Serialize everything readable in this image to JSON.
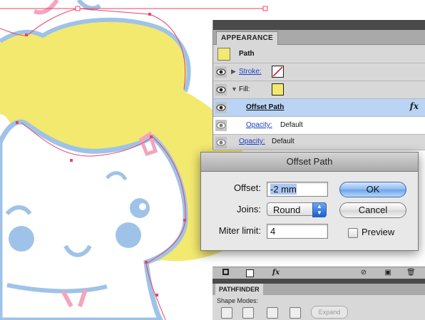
{
  "colors": {
    "artwork_yellow": "#f3e96f",
    "artwork_blue": "#9fc3e8",
    "artwork_pink": "#f2a5bd",
    "selection_red": "#e8446a",
    "dialog_accent_blue": "#6aa3ea",
    "panel_highlight": "#b9d4f5"
  },
  "appearance": {
    "tab_label": "APPEARANCE",
    "path_label": "Path",
    "stroke_label": "Stroke:",
    "fill_label": "Fill:",
    "offset_path_label": "Offset Path",
    "fx_symbol": "fx",
    "opacity_label": "Opacity:",
    "opacity_value": "Default",
    "opacity2_label": "Opacity:",
    "opacity2_value": "Default",
    "icons": [
      "eye-icon",
      "disclosure-triangle-icon",
      "none-swatch-icon",
      "yellow-swatch-icon"
    ]
  },
  "toolbar": {
    "icons": [
      "new-stroke-icon",
      "new-fill-icon",
      "fx-menu-icon",
      "clear-appearance-icon",
      "duplicate-item-icon",
      "trash-icon"
    ],
    "fx_label": "fx"
  },
  "pathfinder": {
    "tab_label": "PATHFINDER",
    "shape_modes_label": "Shape Modes:",
    "expand_label": "Expand"
  },
  "dialog": {
    "title": "Offset Path",
    "offset_label": "Offset:",
    "offset_value": "-2 mm",
    "joins_label": "Joins:",
    "joins_value": "Round",
    "miter_label": "Miter limit:",
    "miter_value": "4",
    "ok_label": "OK",
    "cancel_label": "Cancel",
    "preview_label": "Preview",
    "preview_checked": false
  }
}
